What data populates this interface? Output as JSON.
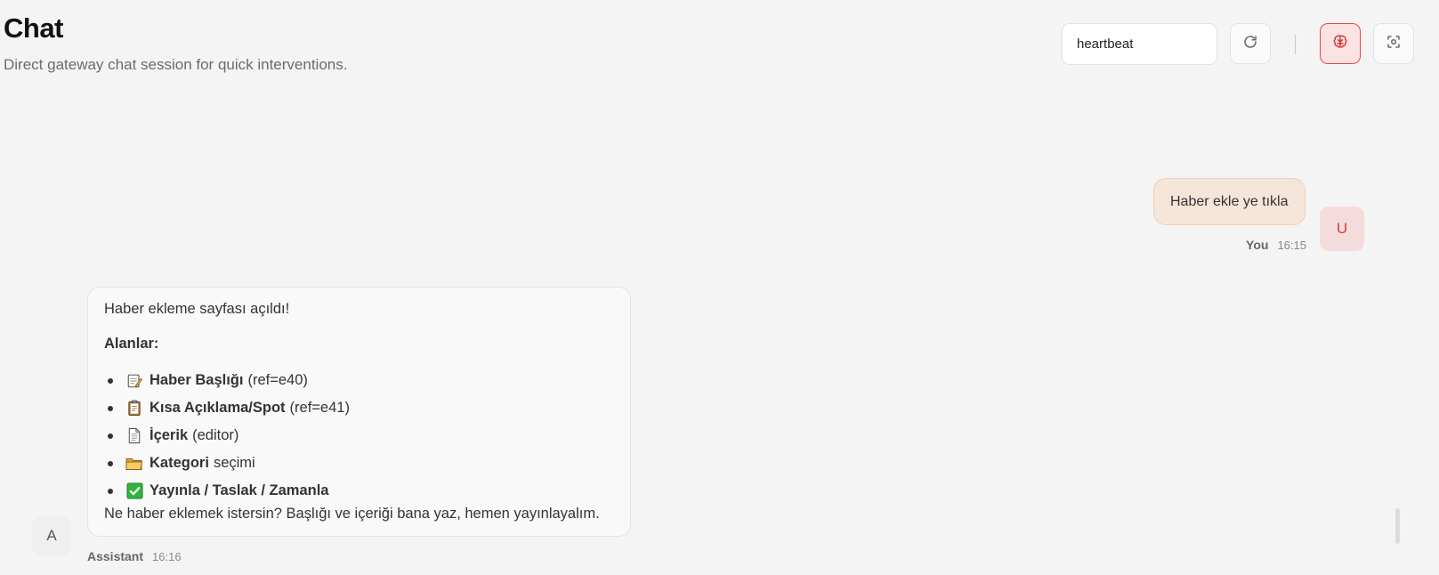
{
  "header": {
    "title": "Chat",
    "subtitle": "Direct gateway chat session for quick interventions."
  },
  "toolbar": {
    "session_value": "heartbeat",
    "refresh_icon": "refresh-icon",
    "brain_icon": "brain-icon",
    "focus_icon": "focus-icon",
    "accent_color": "#e84545"
  },
  "messages": [
    {
      "role": "user",
      "avatar": "U",
      "sender": "You",
      "time": "16:15",
      "text": "Haber ekle ye tıkla"
    },
    {
      "role": "assistant",
      "avatar": "A",
      "sender": "Assistant",
      "time": "16:16",
      "intro": "Haber ekleme sayfası açıldı!",
      "heading": "Alanlar:",
      "fields": [
        {
          "icon": "memo-icon",
          "name": "Haber Başlığı",
          "note": "(ref=e40)"
        },
        {
          "icon": "clipboard-icon",
          "name": "Kısa Açıklama/Spot",
          "note": "(ref=e41)"
        },
        {
          "icon": "page-icon",
          "name": "İçerik",
          "note": "(editor)"
        },
        {
          "icon": "folder-icon",
          "name": "Kategori",
          "note": "seçimi"
        },
        {
          "icon": "check-icon",
          "name": "Yayınla / Taslak / Zamanla",
          "note": ""
        }
      ],
      "closing": "Ne haber eklemek istersin? Başlığı ve içeriği bana yaz, hemen yayınlayalım."
    }
  ]
}
